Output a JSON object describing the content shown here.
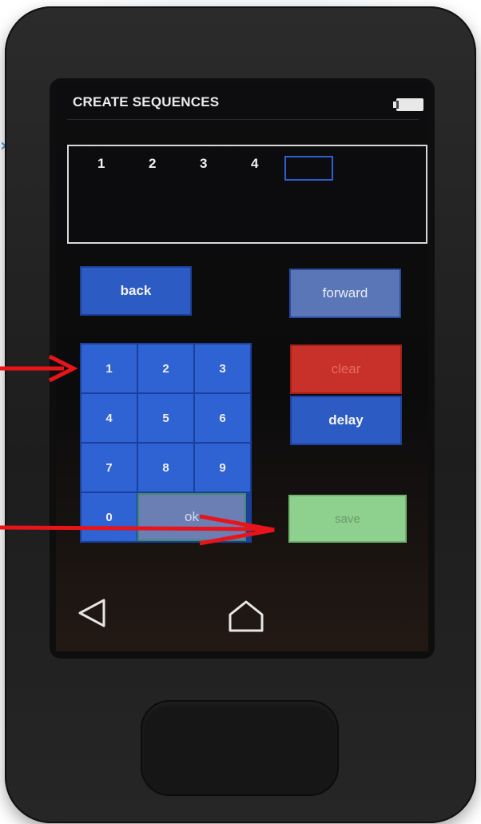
{
  "screen": {
    "title": "CREATE SEQUENCES",
    "sequence": [
      "1",
      "2",
      "3",
      "4"
    ],
    "buttons": {
      "back": "back",
      "forward": "forward",
      "clear": "clear",
      "delay": "delay",
      "save": "save"
    },
    "keypad": {
      "keys": [
        "1",
        "2",
        "3",
        "4",
        "5",
        "6",
        "7",
        "8",
        "9",
        "0"
      ],
      "ok": "ok"
    },
    "nav": {
      "back_icon": "back-triangle-icon",
      "home_icon": "home-icon"
    }
  },
  "colors": {
    "blue_button": "#2c5bc4",
    "clear_button": "#c8302a",
    "save_button": "#8ed08e",
    "annotation_arrow": "#e8141b"
  }
}
